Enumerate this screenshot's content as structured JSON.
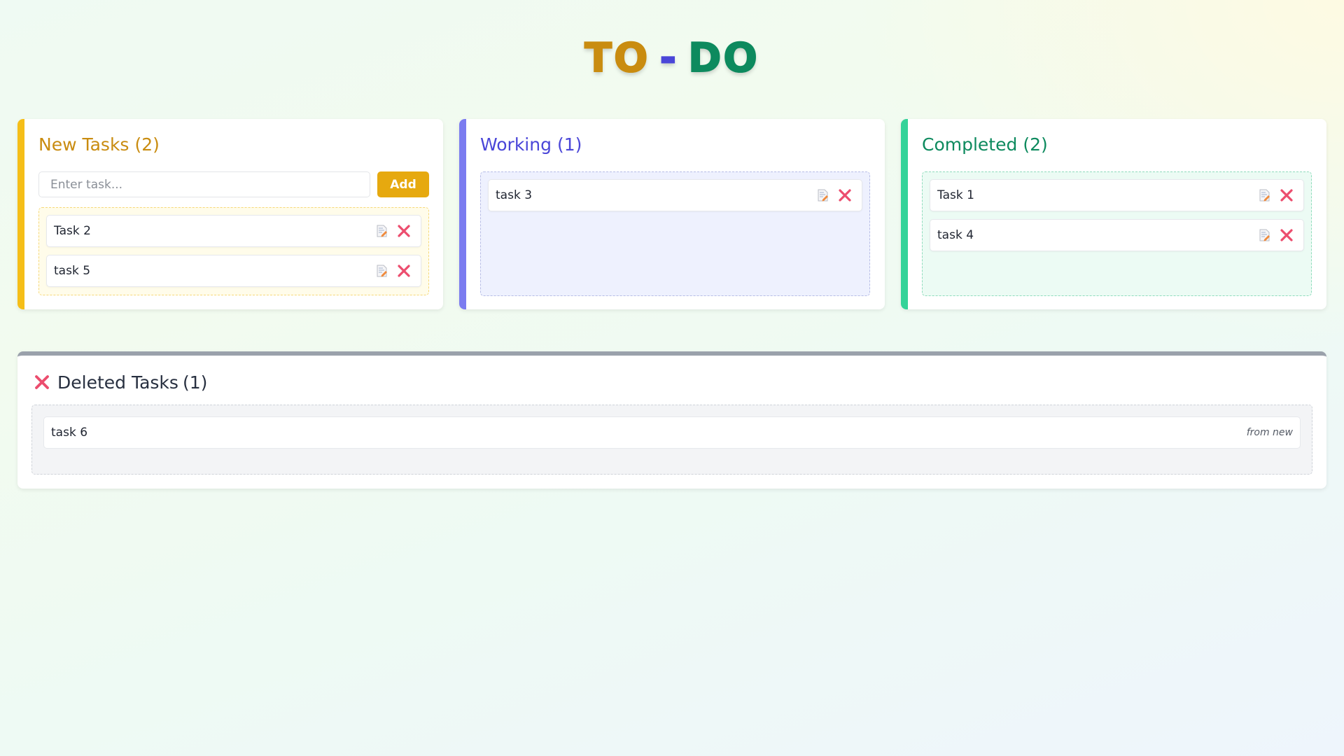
{
  "title": {
    "part1": "TO",
    "separator": "-",
    "part2": "DO"
  },
  "columns": {
    "new": {
      "heading": "New Tasks",
      "count": "(2)",
      "input_placeholder": "Enter task...",
      "add_label": "Add",
      "accent": "#f5be18",
      "heading_color": "#c98c10",
      "tasks": [
        {
          "label": "Task 2"
        },
        {
          "label": "task 5"
        }
      ]
    },
    "working": {
      "heading": "Working",
      "count": "(1)",
      "accent": "#7b7cf0",
      "heading_color": "#4a46d8",
      "tasks": [
        {
          "label": "task 3"
        }
      ]
    },
    "completed": {
      "heading": "Completed",
      "count": "(2)",
      "accent": "#34d399",
      "heading_color": "#0d8a5e",
      "tasks": [
        {
          "label": "Task 1"
        },
        {
          "label": "task 4"
        }
      ]
    }
  },
  "deleted": {
    "heading": "Deleted Tasks",
    "count": "(1)",
    "icon": "close-icon",
    "tasks": [
      {
        "label": "task 6",
        "origin": "from new"
      }
    ]
  },
  "icons": {
    "edit": "edit-icon",
    "delete": "close-icon"
  },
  "colors": {
    "delete_icon": "#ec4d6e",
    "deleted_accent": "#9aa1ab",
    "add_button": "#e6a90f"
  }
}
